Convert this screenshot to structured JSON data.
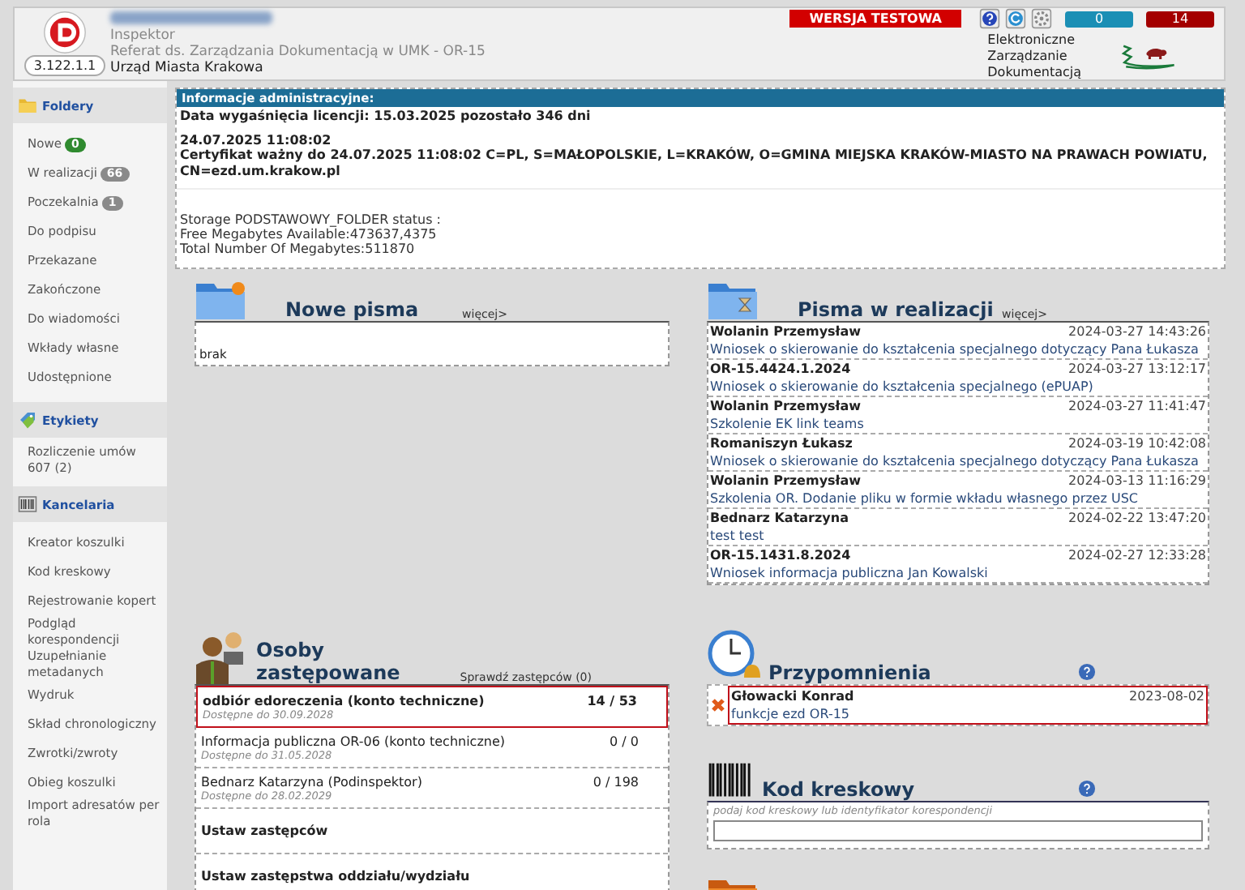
{
  "header": {
    "version": "3.122.1.1",
    "role": "Inspektor",
    "department": "Referat ds. Zarządzania Dokumentacją w UMK - OR-15",
    "office": "Urząd Miasta Krakowa",
    "test_badge": "WERSJA TESTOWA",
    "counters": [
      {
        "value": "0",
        "color": "#1b8fb5"
      },
      {
        "value": "14",
        "color": "#a40000"
      }
    ],
    "brand": [
      "Elektroniczne",
      "Zarządzanie",
      "Dokumentacją"
    ]
  },
  "sidebar": [
    {
      "kind": "folders",
      "title": "Foldery",
      "items": [
        {
          "label": "Nowe",
          "badge": "0",
          "color": "#2f8a2f"
        },
        {
          "label": "W realizacji",
          "badge": "66",
          "color": "#8a8a8a"
        },
        {
          "label": "Poczekalnia",
          "badge": "1",
          "color": "#8a8a8a"
        },
        {
          "label": "Do podpisu"
        },
        {
          "label": "Przekazane"
        },
        {
          "label": "Zakończone"
        },
        {
          "label": "Do wiadomości"
        },
        {
          "label": "Wkłady własne"
        },
        {
          "label": "Udostępnione"
        }
      ]
    },
    {
      "kind": "labels",
      "title": "Etykiety",
      "items": [
        {
          "label": "Rozliczenie umów 607 (2)"
        }
      ]
    },
    {
      "kind": "office",
      "title": "Kancelaria",
      "items": [
        {
          "label": "Kreator koszulki"
        },
        {
          "label": "Kod kreskowy"
        },
        {
          "label": "Rejestrowanie kopert"
        },
        {
          "label": "Podgląd korespondencji"
        },
        {
          "label": "Uzupełnianie metadanych"
        },
        {
          "label": "Wydruk"
        },
        {
          "label": "Skład chronologiczny"
        },
        {
          "label": "Zwrotki/zwroty"
        },
        {
          "label": "Obieg koszulki"
        },
        {
          "label": "Import adresatów per rola"
        }
      ]
    }
  ],
  "admin_info": {
    "title": "Informacje administracyjne:",
    "license": "Data wygaśnięcia licencji: 15.03.2025 pozostało 346 dni",
    "cert_date": "24.07.2025 11:08:02",
    "certificate": "Certyfikat ważny do 24.07.2025 11:08:02 C=PL, S=MAŁOPOLSKIE, L=KRAKÓW, O=GMINA MIEJSKA KRAKÓW-MIASTO NA PRAWACH POWIATU, CN=ezd.um.krakow.pl",
    "storage": [
      "Storage PODSTAWOWY_FOLDER status :",
      "Free Megabytes Available:473637,4375",
      "Total Number Of Megabytes:511870"
    ]
  },
  "new_letters": {
    "title": "Nowe pisma",
    "more": "więcej>",
    "empty": "brak"
  },
  "in_progress": {
    "title": "Pisma w realizacji",
    "more": "więcej>",
    "rows": [
      {
        "sender": "Wolanin Przemysław",
        "date": "2024-03-27 14:43:26",
        "subject": "Wniosek o skierowanie do kształcenia specjalnego dotyczący Pana Łukasza"
      },
      {
        "sender": "OR-15.4424.1.2024",
        "date": "2024-03-27 13:12:17",
        "subject": "Wniosek o skierowanie do kształcenia specjalnego (ePUAP)"
      },
      {
        "sender": "Wolanin Przemysław",
        "date": "2024-03-27 11:41:47",
        "subject": "Szkolenie EK link teams"
      },
      {
        "sender": "Romaniszyn Łukasz",
        "date": "2024-03-19 10:42:08",
        "subject": "Wniosek o skierowanie do kształcenia specjalnego dotyczący Pana Łukasza"
      },
      {
        "sender": "Wolanin Przemysław",
        "date": "2024-03-13 11:16:29",
        "subject": "Szkolenia OR. Dodanie pliku w formie wkładu własnego przez USC"
      },
      {
        "sender": "Bednarz Katarzyna",
        "date": "2024-02-22 13:47:20",
        "subject": "test test"
      },
      {
        "sender": "OR-15.1431.8.2024",
        "date": "2024-02-27 12:33:28",
        "subject": "Wniosek informacja publiczna Jan Kowalski"
      }
    ]
  },
  "substitutes": {
    "title": "Osoby zastępowane",
    "check": "Sprawdź zastępców (0)",
    "rows": [
      {
        "name": "odbiór edoreczenia (konto techniczne)",
        "available": "Dostępne do 30.09.2028",
        "count": "14 / 53",
        "highlighted": true
      },
      {
        "name": "Informacja publiczna OR-06 (konto techniczne)",
        "available": "Dostępne do 31.05.2028",
        "count": "0 / 0",
        "highlighted": false
      },
      {
        "name": "Bednarz Katarzyna (Podinspektor)",
        "available": "Dostępne do 28.02.2029",
        "count": "0 / 198",
        "highlighted": false
      }
    ],
    "actions": [
      "Ustaw zastępców",
      "Ustaw zastępstwa oddziału/wydziału"
    ]
  },
  "reminders": {
    "title": "Przypomnienia",
    "rows": [
      {
        "name": "Głowacki Konrad",
        "date": "2023-08-02",
        "text": "funkcje ezd OR-15",
        "highlighted": true
      }
    ]
  },
  "barcode": {
    "title": "Kod kreskowy",
    "hint": "podaj kod kreskowy lub identyfikator korespondencji"
  }
}
